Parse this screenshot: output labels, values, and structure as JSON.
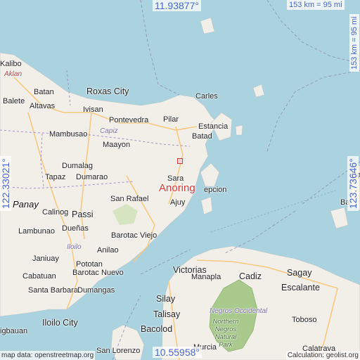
{
  "map": {
    "location_name": "Anoring",
    "coords": {
      "top": "11.93877°",
      "bottom": "10.55958°",
      "left": "122.33021°",
      "right": "123.73646°"
    },
    "scale": {
      "horizontal": "153 km = 95 mi",
      "vertical": "153 km = 95 mi"
    },
    "footer": {
      "attribution": "map data: openstreetmap.org",
      "calculation": "Calculation: geolist.org"
    },
    "places": {
      "kalibo": "Kalibo",
      "aklan": "Aklan",
      "batan": "Batan",
      "balete": "Balete",
      "altavas": "Altavas",
      "roxas_city": "Roxas City",
      "ivisan": "Ivisan",
      "pontevedra": "Pontevedra",
      "pilar": "Pilar",
      "carles": "Carles",
      "estancia": "Estancia",
      "batad": "Batad",
      "mambusao": "Mambusao",
      "capiz": "Capiz",
      "maayon": "Maayon",
      "dumalag": "Dumalag",
      "tapaz": "Tapaz",
      "dumarao": "Dumarao",
      "sara": "Sara",
      "concepcion": "epcion",
      "panay": "Panay",
      "calinog": "Calinog",
      "san_rafael": "San Rafael",
      "ajuy": "Ajuy",
      "passi": "Passi",
      "lambunao": "Lambunao",
      "duenas": "Dueñas",
      "barotac_viejo": "Barotac Viejo",
      "iloilo": "Iloilo",
      "janiuay": "Janiuay",
      "anilao": "Anilao",
      "pototan": "Pototan",
      "cabatuan": "Cabatuan",
      "barotac_nuevo": "Barotac Nuevo",
      "santa_barbara": "Santa Barbara",
      "dumangas": "Dumangas",
      "iloilo_city": "Iloilo City",
      "oton": "igbauan",
      "manapla": "Manapla",
      "cadiz": "Cadiz",
      "victorias": "Victorias",
      "sagay": "Sagay",
      "escalante": "Escalante",
      "silay": "Silay",
      "talisay": "Talisay",
      "negros_occidental": "Negros Occidental",
      "northern_negros_park": "Northern Negros Natural Park",
      "toboso": "Toboso",
      "bacolod": "Bacolod",
      "san_lorenzo": "San Lorenzo",
      "murcia": "Murcia",
      "calatrava": "Calatrava",
      "ba_east": "Ba",
      "ba_east2": "Ba"
    }
  },
  "colors": {
    "water": "#aad3df",
    "land": "#f2efe9",
    "park": "#aac98d",
    "road": "#f7c87f",
    "coord": "#4a66cc",
    "marker": "#d83a3a"
  }
}
